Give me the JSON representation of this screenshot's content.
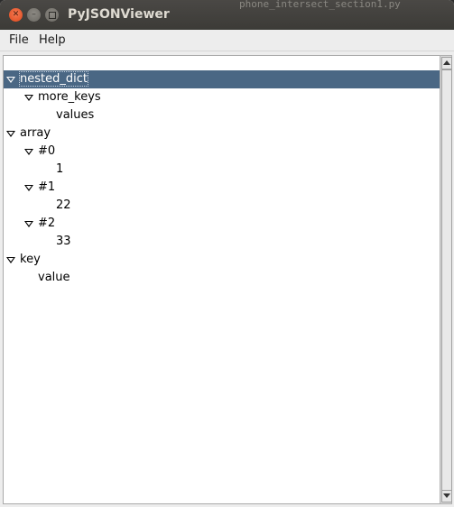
{
  "window": {
    "title": "PyJSONViewer",
    "background_title": "phone_intersect_section1.py"
  },
  "menu": {
    "items": [
      {
        "label": "File"
      },
      {
        "label": "Help"
      }
    ]
  },
  "tree": {
    "rows": [
      {
        "label": "nested_dict",
        "expandable": true,
        "expanded": true,
        "selected": true,
        "depth": 0
      },
      {
        "label": "more_keys",
        "expandable": true,
        "expanded": true,
        "selected": false,
        "depth": 1
      },
      {
        "label": "values",
        "expandable": false,
        "selected": false,
        "depth": 2
      },
      {
        "label": "array",
        "expandable": true,
        "expanded": true,
        "selected": false,
        "depth": 0
      },
      {
        "label": "#0",
        "expandable": true,
        "expanded": true,
        "selected": false,
        "depth": 1
      },
      {
        "label": "1",
        "expandable": false,
        "selected": false,
        "depth": 2
      },
      {
        "label": "#1",
        "expandable": true,
        "expanded": true,
        "selected": false,
        "depth": 1
      },
      {
        "label": "22",
        "expandable": false,
        "selected": false,
        "depth": 2
      },
      {
        "label": "#2",
        "expandable": true,
        "expanded": true,
        "selected": false,
        "depth": 1
      },
      {
        "label": "33",
        "expandable": false,
        "selected": false,
        "depth": 2
      },
      {
        "label": "key",
        "expandable": true,
        "expanded": true,
        "selected": false,
        "depth": 0
      },
      {
        "label": "value",
        "expandable": false,
        "selected": false,
        "depth": 1
      }
    ]
  },
  "colors": {
    "selection": "#4a6784",
    "close_button": "#e0491b",
    "titlebar": "#3c3b37"
  },
  "icons": {
    "expand": "triangle-down-icon",
    "close": "close-icon",
    "minimize": "minimize-icon",
    "maximize": "maximize-icon"
  }
}
